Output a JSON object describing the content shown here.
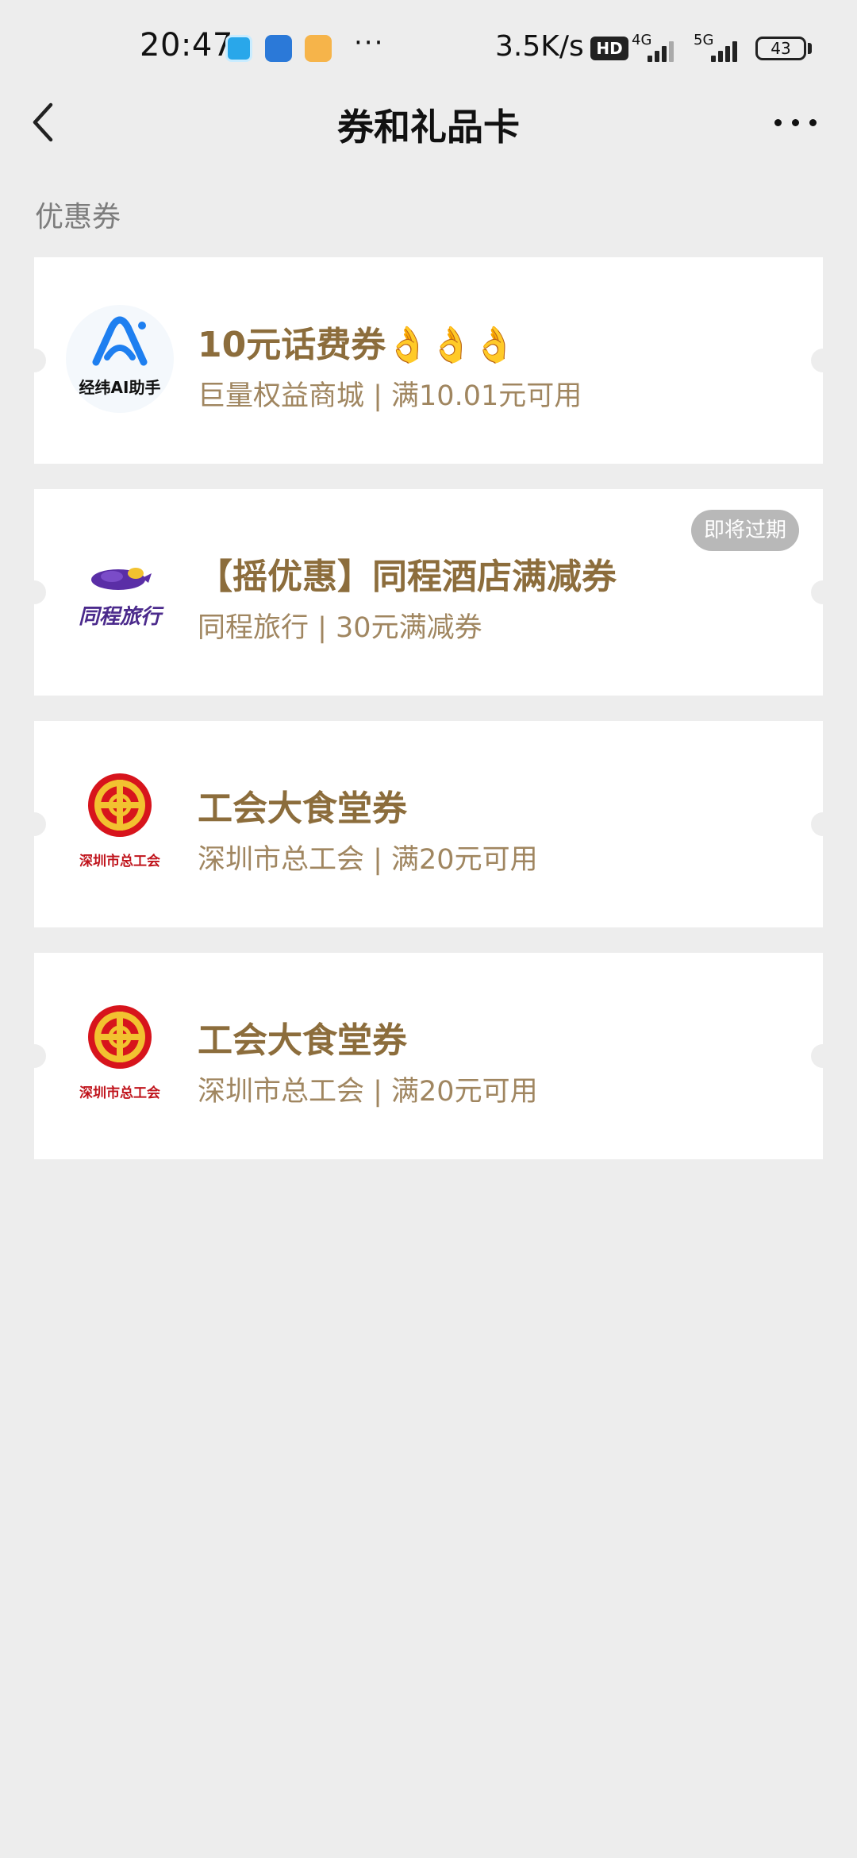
{
  "status_bar": {
    "time": "20:47",
    "more": "···",
    "net_speed": "3.5K/s",
    "hd_badge": "HD",
    "net_1": "4G",
    "net_2": "5G",
    "battery": "43",
    "app_icons": [
      "weather-app-icon",
      "files-app-icon",
      "gallery-app-icon"
    ]
  },
  "nav": {
    "title": "券和礼品卡"
  },
  "section": {
    "title": "优惠券"
  },
  "coupons": [
    {
      "title": "10元话费券👌👌👌",
      "subtitle": "巨量权益商城 | 满10.01元可用",
      "logo": "jingwei-ai-logo",
      "logo_label": "经纬AI助手"
    },
    {
      "title": "【摇优惠】同程酒店满减券",
      "subtitle": "同程旅行 | 30元满减券",
      "logo": "tongcheng-travel-logo",
      "logo_label": "同程旅行",
      "badge": "即将过期"
    },
    {
      "title": "工会大食堂券",
      "subtitle": "深圳市总工会 | 满20元可用",
      "logo": "trade-union-logo",
      "logo_label": "深圳市总工会"
    },
    {
      "title": "工会大食堂券",
      "subtitle": "深圳市总工会 | 满20元可用",
      "logo": "trade-union-logo",
      "logo_label": "深圳市总工会"
    }
  ],
  "colors": {
    "background": "#ededed",
    "coupon_title": "#8c6d3c",
    "coupon_subtitle": "#a08660",
    "badge_bg": "#b8b8b8"
  }
}
